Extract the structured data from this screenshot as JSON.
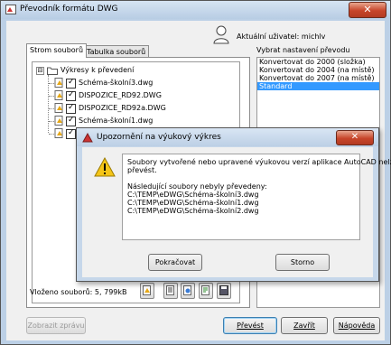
{
  "window": {
    "title": "Převodník formátu DWG",
    "close_glyph": "✕"
  },
  "user": {
    "label": "Aktuální uživatel: michlv",
    "icon": "user-icon"
  },
  "tabs": [
    {
      "label": "Strom souborů",
      "active": true
    },
    {
      "label": "Tabulka souborů",
      "active": false
    }
  ],
  "tree": {
    "root": {
      "label": "Výkresy k převedení",
      "expander": "⊟",
      "icon": "drawings-folder-icon"
    },
    "items": [
      {
        "label": "Schéma-školní3.dwg"
      },
      {
        "label": "DISPOZICE_RD92.DWG"
      },
      {
        "label": "DISPOZICE_RD92a.DWG"
      },
      {
        "label": "Schéma-školní1.dwg"
      },
      {
        "label": ""
      }
    ]
  },
  "presets": {
    "label": "Vybrat nastavení převodu",
    "items": [
      {
        "label": "Konvertovat do 2000 (složka)",
        "selected": false
      },
      {
        "label": "Konvertovat do 2004 (na místě)",
        "selected": false
      },
      {
        "label": "Konvertovat do 2007 (na místě)",
        "selected": false
      },
      {
        "label": "Standard",
        "selected": true
      }
    ]
  },
  "status": {
    "file_size": "Vloženo souborů: 5, 799kB"
  },
  "toolbar_icons": [
    "add-file-icon",
    "open-list-icon",
    "transmittal-icon",
    "new-list-icon",
    "save-list-icon"
  ],
  "buttons": {
    "report": "Zobrazit zprávu",
    "convert": "Převést",
    "close": "Zavřít",
    "help": "Nápověda"
  },
  "dialog": {
    "title": "Upozornění na výukový výkres",
    "close_glyph": "✕",
    "message_lines": [
      "Soubory vytvořené nebo upravené výukovou verzí aplikace AutoCAD nelze",
      "převést.",
      "",
      "Následující soubory nebyly převedeny:",
      "C:\\TEMP\\eDWG\\Schéma-školní3.dwg",
      "C:\\TEMP\\eDWG\\Schéma-školní1.dwg",
      "C:\\TEMP\\eDWG\\Schéma-školní2.dwg"
    ],
    "continue_label": "Pokračovat",
    "cancel_label": "Storno"
  },
  "colors": {
    "selection": "#3399ff",
    "frame": "#bcd0e6",
    "close_red": "#c7452a"
  }
}
